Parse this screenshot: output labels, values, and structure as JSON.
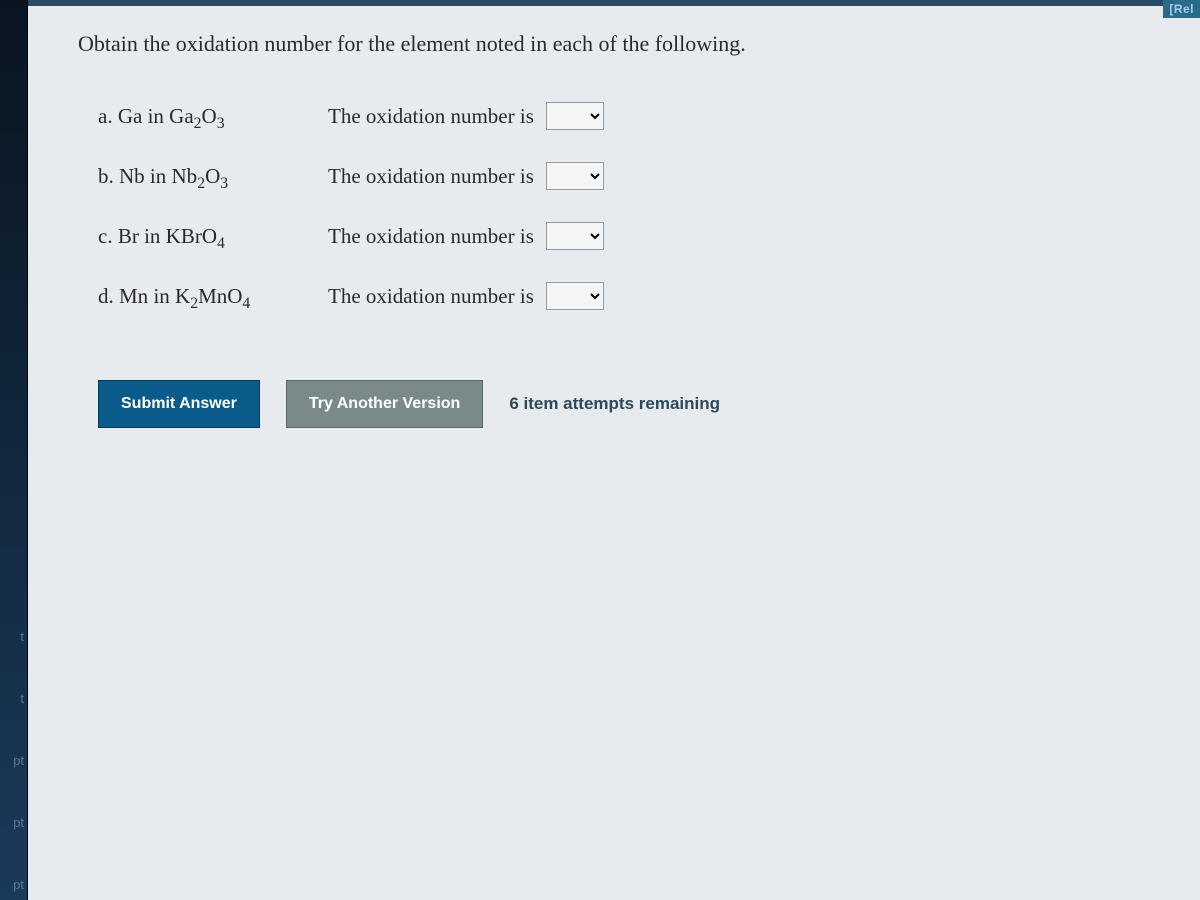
{
  "top_corner_label": "[Rel",
  "sidebar": {
    "items": [
      "t",
      "t",
      "pt",
      "pt",
      "pt"
    ]
  },
  "question": {
    "prompt": "Obtain the oxidation number for the element noted in each of the following.",
    "oxidation_label": "The oxidation number is",
    "parts": [
      {
        "letter": "a.",
        "element": "Ga",
        "in": "in",
        "compound_pre": "Ga",
        "sub1": "2",
        "mid": "O",
        "sub2": "3"
      },
      {
        "letter": "b.",
        "element": "Nb",
        "in": "in",
        "compound_pre": "Nb",
        "sub1": "2",
        "mid": "O",
        "sub2": "3"
      },
      {
        "letter": "c.",
        "element": "Br",
        "in": "in",
        "compound_pre": "KBrO",
        "sub1": "4",
        "mid": "",
        "sub2": ""
      },
      {
        "letter": "d.",
        "element": "Mn",
        "in": "in",
        "compound_pre": "K",
        "sub1": "2",
        "mid": "MnO",
        "sub2": "4"
      }
    ]
  },
  "buttons": {
    "submit": "Submit Answer",
    "try_another": "Try Another Version"
  },
  "attempts_text": "6 item attempts remaining"
}
